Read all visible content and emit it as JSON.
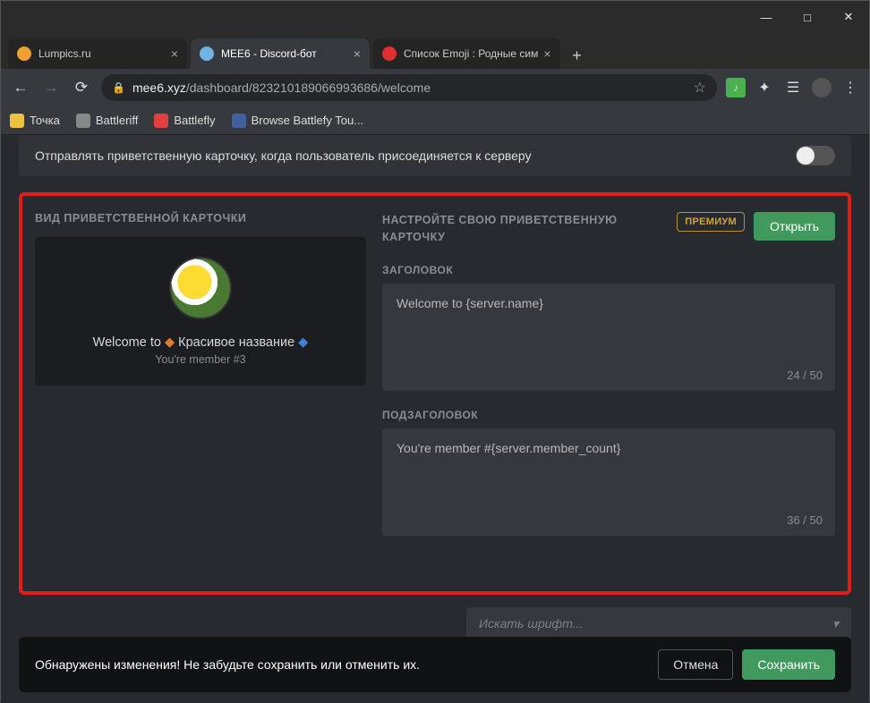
{
  "window": {
    "minimize": "—",
    "maximize": "□",
    "close": "✕"
  },
  "tabs": [
    {
      "title": "Lumpics.ru",
      "fav_color": "#f0a030"
    },
    {
      "title": "MEE6 - Discord-бот",
      "fav_color": "#6fb4e3",
      "active": true
    },
    {
      "title": "Список Emoji : Родные сим",
      "fav_color": "#e03030"
    }
  ],
  "omnibox": {
    "host": "mee6.xyz",
    "path": "/dashboard/823210189066993686/welcome"
  },
  "bookmarks": [
    {
      "label": "Точка",
      "color": "#f0c040"
    },
    {
      "label": "Battleriff",
      "color": "#888"
    },
    {
      "label": "Battlefly",
      "color": "#e04040"
    },
    {
      "label": "Browse Battlefy Tou...",
      "color": "#4060a0"
    }
  ],
  "page": {
    "toggle_label": "Отправлять приветственную карточку, когда пользователь присоединяется к серверу",
    "preview_heading": "ВИД ПРИВЕТСТВЕННОЙ КАРТОЧКИ",
    "card": {
      "line1_prefix": "Welcome to ",
      "server_name": "Красивое название",
      "line2": "You're member #3"
    },
    "settings_heading": "НАСТРОЙТЕ СВОЮ ПРИВЕТСТВЕННУЮ КАРТОЧКУ",
    "premium_label": "ПРЕМИУМ",
    "open_label": "Открыть",
    "title_field": {
      "label": "ЗАГОЛОВОК",
      "value": "Welcome to {server.name}",
      "count": "24 / 50"
    },
    "subtitle_field": {
      "label": "ПОДЗАГОЛОВОК",
      "value": "You're member #{server.member_count}",
      "count": "36 / 50"
    },
    "font_placeholder": "Искать шрифт..."
  },
  "savebar": {
    "message": "Обнаружены изменения! Не забудьте сохранить или отменить их.",
    "cancel": "Отмена",
    "save": "Сохранить"
  }
}
